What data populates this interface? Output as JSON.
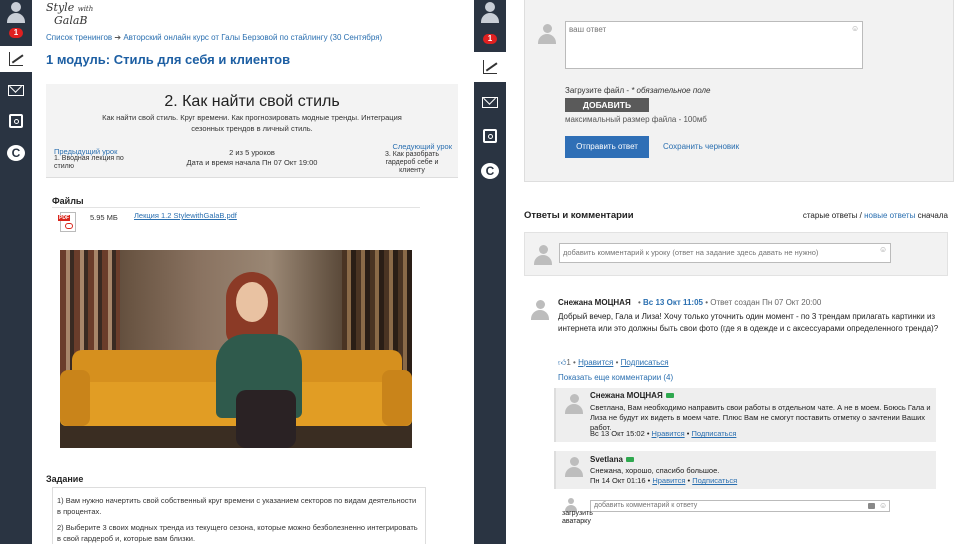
{
  "left_rail": {
    "notifications_count": "1"
  },
  "right_rail": {
    "notifications_count": "1"
  },
  "header": {
    "logo_line1": "Style",
    "logo_with": "with",
    "logo_line2": "GalaB",
    "breadcrumb_root": "Список тренингов",
    "breadcrumb_arrow": "➔",
    "breadcrumb_course": "Авторский онлайн курс от Галы Берзовой по стайлингу (30 Сентября)",
    "module_title": "1 модуль: Стиль для себя и клиентов"
  },
  "lesson": {
    "title": "2. Как найти свой стиль",
    "subtitle": "Как найти свой стиль. Круг времени. Как прогнозировать модные тренды. Интеграция сезонных трендов в личный стиль.",
    "prev_label": "Предыдущий урок",
    "prev_title": "1. Вводная лекция по стилю",
    "progress": "2 из 5 уроков",
    "start_date": "Дата и время начала Пн 07 Окт 19:00",
    "next_label": "Следующий урок",
    "next_title": "3. Как разобрать гардероб себе и клиенту"
  },
  "files": {
    "heading": "Файлы",
    "items": [
      {
        "type_badge": "PDF",
        "size": "5.95 МБ",
        "name": "Лекция 1.2 StylewithGalaB.pdf"
      }
    ]
  },
  "task": {
    "heading": "Задание",
    "items": [
      "1) Вам нужно начертить свой собственный круг времени с указанием секторов по видам деятельности в процентах.",
      "2) Выберите 3 своих модных тренда из текущего сезона, которые можно безболезненно интегрировать в свой гардероб и, которые вам близки."
    ]
  },
  "answer_form": {
    "placeholder": "ваш ответ",
    "upload_label": "Загрузите файл - ",
    "upload_required": "* обязательное поле",
    "add_button": "ДОБАВИТЬ",
    "max_size": "максимальный размер файла - 100мб",
    "submit_button": "Отправить ответ",
    "draft_link": "Сохранить черновик"
  },
  "comments": {
    "heading": "Ответы и комментарии",
    "sort_old": "старые ответы",
    "sort_sep": " / ",
    "sort_new": "новые ответы",
    "sort_suffix": " сначала",
    "comment_placeholder": "добавить комментарий к уроку (ответ на задание здесь давать не нужно)",
    "main": {
      "author": "Снежана МОЦНАЯ",
      "date": "Вс 13 Окт 11:05",
      "created": "Ответ создан Пн 07 Окт 20:00",
      "text": "Добрый вечер, Гала и Лиза! Хочу только уточнить один момент - по 3 трендам прилагать картинки из интернета или это должны быть свои фото (где я в одежде и с аксессуарами определенного тренда)?",
      "likes": "1",
      "like_link": "Нравится",
      "subscribe_link": "Подписаться",
      "more_link": "Показать еще комментарии (4)"
    },
    "replies": [
      {
        "author": "Снежана МОЦНАЯ",
        "text": "Светлана, Вам необходимо направить свои работы в отдельном чате. А не в моем. Боюсь Гала и Лиза не будут их видеть в моем чате. Плюс Вам не смогут поставить отметку о зачтении Ваших работ.",
        "date": "Вс 13 Окт 15:02",
        "like_link": "Нравится",
        "subscribe_link": "Подписаться"
      },
      {
        "author": "Svetlana",
        "text": "Снежана, хорошо, спасибо большое.",
        "date": "Пн 14 Окт 01:16",
        "like_link": "Нравится",
        "subscribe_link": "Подписаться"
      }
    ],
    "reply_placeholder": "добавить комментарий к ответу",
    "upload_avatar": "загрузить аватарку"
  }
}
